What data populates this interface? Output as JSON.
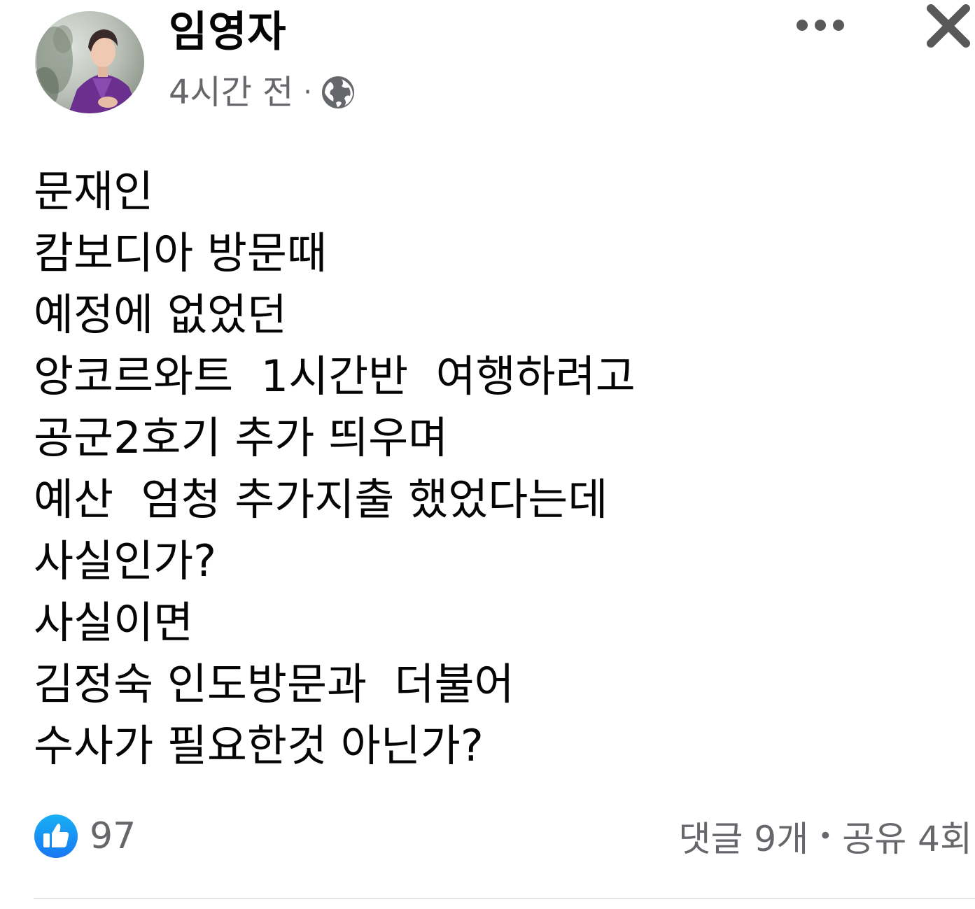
{
  "post": {
    "author": "임영자",
    "time": "4시간 전",
    "separator": "·",
    "audience_icon": "globe-icon",
    "lines": [
      "문재인",
      "캄보디아 방문때",
      "예정에 없었던",
      "앙코르와트  1시간반  여행하려고",
      "공군2호기 추가 띄우며",
      "예산  엄청 추가지출 했었다는데",
      "사실인가?",
      "사실이면",
      "김정숙 인도방문과  더불어",
      "수사가 필요한것 아닌가?"
    ]
  },
  "footer": {
    "like_count": "97",
    "comments": "댓글 9개",
    "bullet": "•",
    "shares": "공유 4회"
  },
  "colors": {
    "text": "#050505",
    "secondary_text": "#65676b",
    "like_blue": "#1877f2",
    "divider": "#e4e6eb",
    "close_icon": "#595959"
  }
}
